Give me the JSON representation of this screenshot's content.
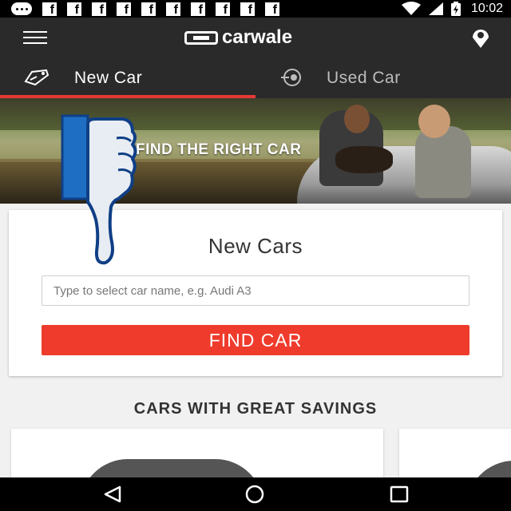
{
  "status_bar": {
    "time": "10:02",
    "notification_icons": [
      "message-dots-icon",
      "facebook-icon",
      "facebook-icon",
      "facebook-icon",
      "facebook-icon",
      "facebook-icon",
      "facebook-icon",
      "facebook-icon",
      "facebook-icon",
      "facebook-icon",
      "facebook-icon"
    ],
    "system_icons": [
      "wifi-icon",
      "signal-icon",
      "battery-charging-icon"
    ]
  },
  "app_bar": {
    "logo_text": "carwale",
    "menu_icon": "hamburger-menu-icon",
    "location_icon": "location-pin-icon"
  },
  "tabs": [
    {
      "label": "New Car",
      "icon": "car-tag-icon",
      "selected": true
    },
    {
      "label": "Used Car",
      "icon": "car-key-icon",
      "selected": false
    }
  ],
  "colors": {
    "accent": "#e53935",
    "button": "#ef3b2c",
    "app_bar": "#2a2a2a",
    "overlay_blue": "#1565c0"
  },
  "banner": {
    "heading": "FIND THE RIGHT CAR"
  },
  "search_card": {
    "title": "New Cars",
    "placeholder": "Type to select car name, e.g. Audi A3",
    "button_label": "FIND CAR"
  },
  "savings": {
    "heading": "CARS WITH GREAT SAVINGS"
  },
  "overlay": {
    "icon": "thumbs-down-icon"
  },
  "nav_bar": {
    "buttons": [
      "back-icon",
      "home-icon",
      "recent-apps-icon"
    ]
  }
}
